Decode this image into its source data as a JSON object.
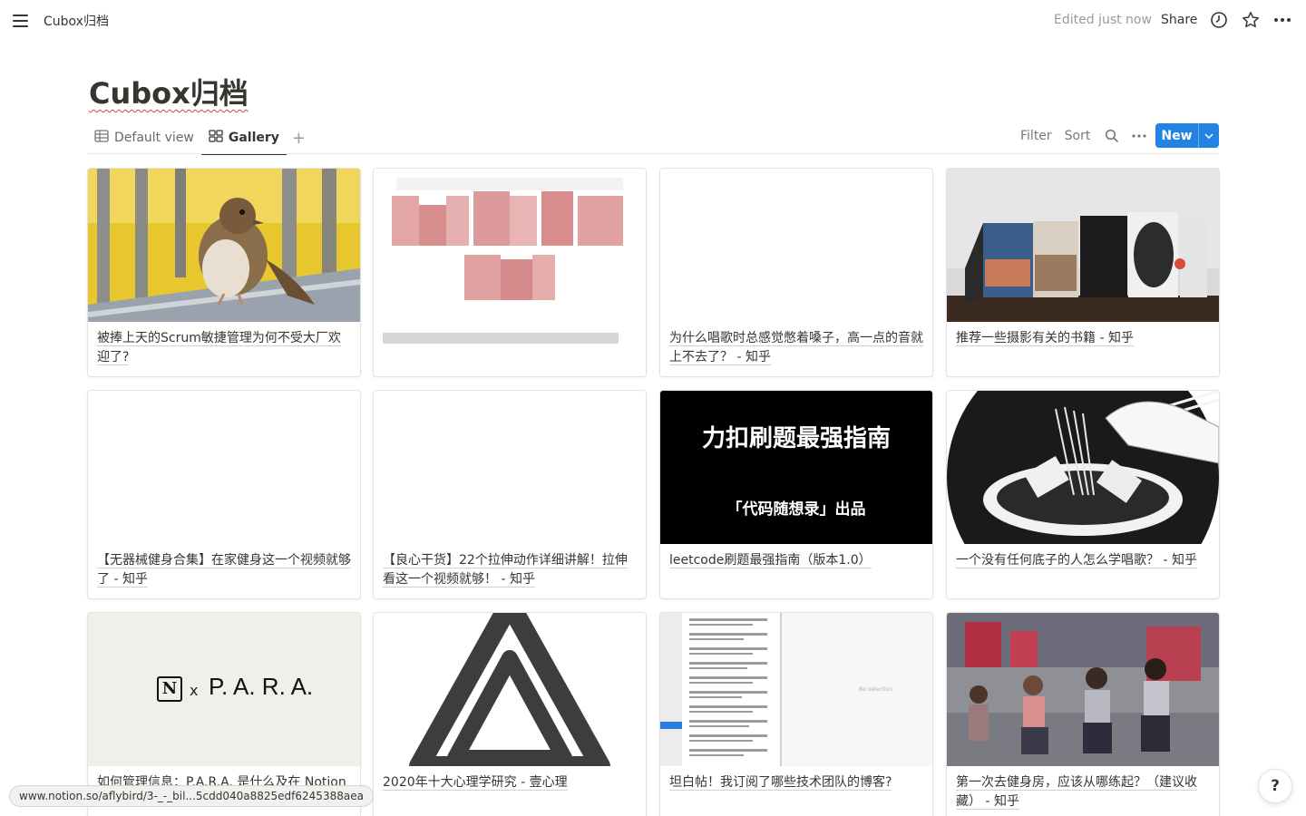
{
  "breadcrumb": "Cubox归档",
  "topbar": {
    "edited": "Edited just now",
    "share": "Share"
  },
  "page_title": "Cubox归档",
  "views": {
    "default_label": "Default view",
    "gallery_label": "Gallery",
    "add": "+"
  },
  "toolbar": {
    "filter": "Filter",
    "sort": "Sort",
    "new_label": "New"
  },
  "cards": [
    {
      "title": "被捧上天的Scrum敏捷管理为何不受大厂欢迎了?",
      "cover": "sparrow-photo"
    },
    {
      "title": "",
      "cover": "pixelated-image"
    },
    {
      "title": "为什么唱歌时总感觉憋着嗓子，高一点的音就上不去了？ - 知乎",
      "cover": "blank"
    },
    {
      "title": "推荐一些摄影有关的书籍 - 知乎",
      "cover": "photography-books"
    },
    {
      "title": "【无器械健身合集】在家健身这一个视频就够了 - 知乎",
      "cover": "blank"
    },
    {
      "title": "【良心干货】22个拉伸动作详细讲解！拉伸看这一个视频就够！ - 知乎",
      "cover": "blank"
    },
    {
      "title": "leetcode刷题最强指南（版本1.0）",
      "cover": "black-text",
      "cover_text_1": "力扣刷题最强指南",
      "cover_text_2": "「代码随想录」出品"
    },
    {
      "title": "一个没有任何底子的人怎么学唱歌？ - 知乎",
      "cover": "noodle-illustration"
    },
    {
      "title": "如何管理信息：P.A.R.A. 是什么及在 Notion",
      "cover": "notion-para",
      "cover_text_1": "x",
      "cover_text_2": "P. A. R. A."
    },
    {
      "title": "2020年十大心理学研究 - 壹心理",
      "cover": "impossible-triangle"
    },
    {
      "title": "坦白帖！我订阅了哪些技术团队的博客?",
      "cover": "rss-screenshot",
      "cover_text_1": "No selection"
    },
    {
      "title": "第一次去健身房，应该从哪练起？（建议收藏） - 知乎",
      "cover": "gym-photo"
    }
  ],
  "status_url": "www.notion.so/aflybird/3-_-_bil...5cdd040a8825edf6245388aea",
  "help": "?"
}
